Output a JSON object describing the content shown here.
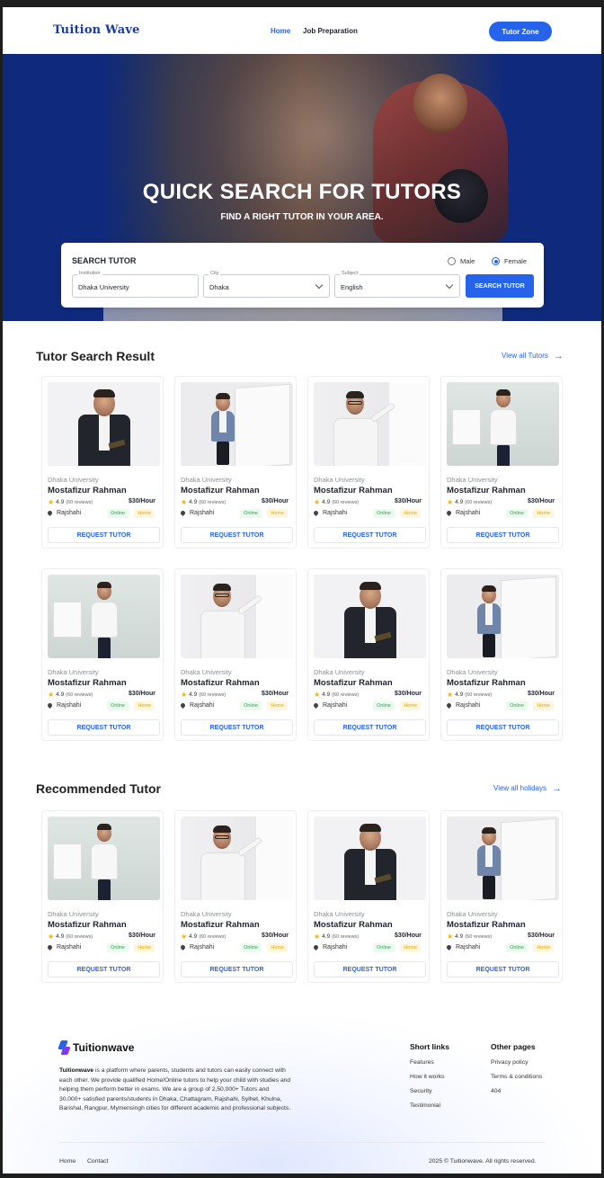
{
  "nav": {
    "brand": "Tuition Wave",
    "links": [
      "Home",
      "Job Preparation"
    ],
    "cta": "Tutor Zone"
  },
  "hero": {
    "title": "QUICK SEARCH FOR TUTORS",
    "subtitle": "FIND A RIGHT TUTOR IN YOUR AREA."
  },
  "search": {
    "title": "SEARCH TUTOR",
    "gender_options": [
      "Male",
      "Female"
    ],
    "gender_selected": "Female",
    "institution": {
      "label": "Institution",
      "value": "Dhaka University"
    },
    "city": {
      "label": "City",
      "value": "Dhaka"
    },
    "subject": {
      "label": "Subject",
      "value": "English"
    },
    "button": "SEARCH TUTOR"
  },
  "results": {
    "title": "Tutor Search Result",
    "view_all": "View all Tutors"
  },
  "recommended": {
    "title": "Recommended Tutor",
    "view_all": "View all holidays"
  },
  "tutor": {
    "institution": "Dhaka University",
    "name": "Mostafizur Rahman",
    "rating": "4.9",
    "reviews": "(60 reviews)",
    "price": "$30/Hour",
    "location": "Rajshahi",
    "badge_online": "Online",
    "badge_home": "Home",
    "request": "REQUEST TUTOR"
  },
  "footer": {
    "brand": "Tuitionwave",
    "desc_brand": "Tuitionwave",
    "description": " is a platform where parents, students and tutors can easily connect with each other. We provide qualified Home/Online tutors to help your child with studies and helping them perform better in exams. We are a group of 2,50,000+ Tutors and 30,000+ satisfied parents/students in Dhaka, Chattagram, Rajshahi, Sylhet, Khulna, Barishal, Rangpur, Mymensingh cities for different academic and professional subjects.",
    "short_links_title": "Short links",
    "short_links": [
      "Features",
      "How it works",
      "Security",
      "Testimonial"
    ],
    "other_pages_title": "Other pages",
    "other_pages": [
      "Privacy policy",
      "Terms & conditions",
      "404"
    ],
    "bottom_links": [
      "Home",
      "Contact"
    ],
    "copyright": "2025 © Tuitionwave. All rights reserved."
  },
  "colors": {
    "primary": "#2563eb",
    "hero_bg": "#0f2a7d",
    "online": "#2ea44f",
    "home": "#e5a400",
    "star": "#f5b400"
  }
}
